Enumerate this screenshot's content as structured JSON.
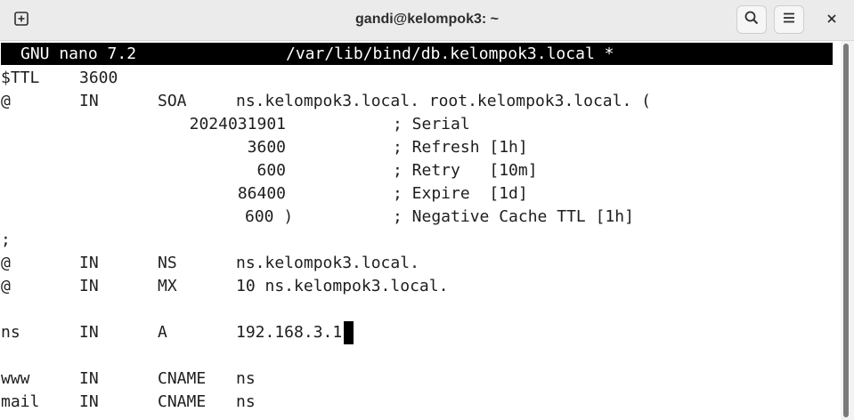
{
  "window": {
    "title": "gandi@kelompok3: ~",
    "icons": {
      "new_tab": "plus-box-icon",
      "search": "search-icon",
      "menu": "hamburger-menu-icon",
      "close": "close-icon"
    }
  },
  "nano": {
    "version": "GNU nano 7.2",
    "filename": "/var/lib/bind/db.kelompok3.local *"
  },
  "zone": {
    "ttl_line": [
      "$TTL",
      "3600"
    ],
    "soa_line": [
      "@",
      "IN",
      "SOA",
      "ns.kelompok3.local. root.kelompok3.local. ("
    ],
    "soa_values": [
      {
        "value": "2024031901",
        "comment": "; Serial"
      },
      {
        "value": "3600",
        "comment": "; Refresh [1h]"
      },
      {
        "value": "600",
        "comment": "; Retry   [10m]"
      },
      {
        "value": "86400",
        "comment": "; Expire  [1d]"
      },
      {
        "value": "600 )",
        "comment": "; Negative Cache TTL [1h]"
      }
    ],
    "separator": ";",
    "records": [
      {
        "name": "@",
        "class": "IN",
        "type": "NS",
        "data": "ns.kelompok3.local."
      },
      {
        "name": "@",
        "class": "IN",
        "type": "MX",
        "data": "10 ns.kelompok3.local."
      },
      {
        "name": "ns",
        "class": "IN",
        "type": "A",
        "data": "192.168.3.1"
      },
      {
        "name": "www",
        "class": "IN",
        "type": "CNAME",
        "data": "ns"
      },
      {
        "name": "mail",
        "class": "IN",
        "type": "CNAME",
        "data": "ns"
      }
    ]
  }
}
